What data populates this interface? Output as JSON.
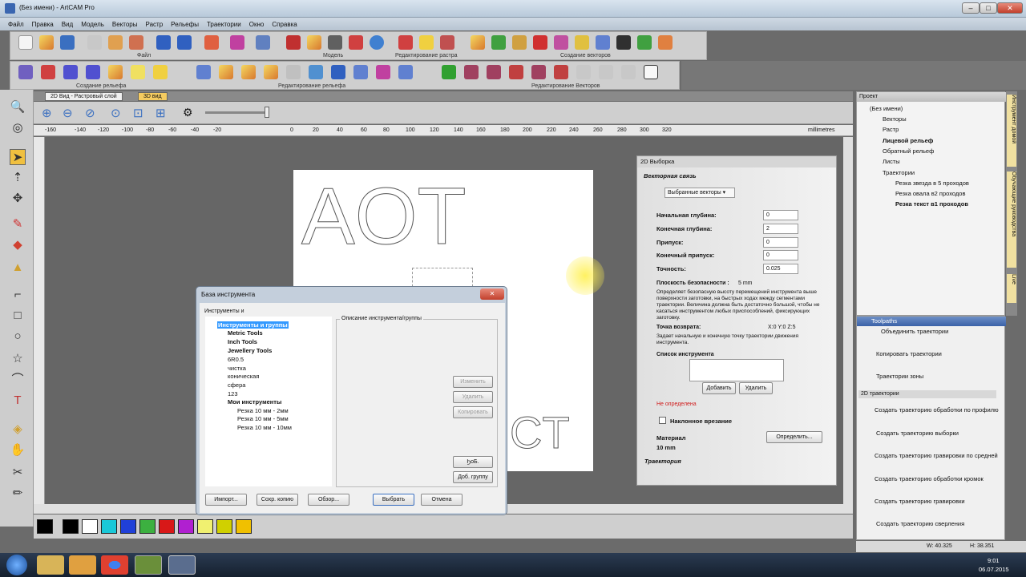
{
  "app": {
    "title": "(Без имени) - ArtCAM Pro"
  },
  "menu": [
    "Файл",
    "Правка",
    "Вид",
    "Модель",
    "Векторы",
    "Растр",
    "Рельефы",
    "Траектории",
    "Окно",
    "Справка"
  ],
  "toolbar_labels": {
    "file": "Файл",
    "model": "Модель",
    "raster_edit": "Редактирование растра",
    "vector_create": "Создание векторов",
    "relief_create": "Создание рельефа",
    "relief_edit": "Редактирование рельефа",
    "vector_edit": "Редактирование Векторов"
  },
  "view_tabs": [
    "2D Вид - Растровый слой",
    "3D вид"
  ],
  "ruler": {
    "ticks": [
      "-160",
      "-140",
      "-120",
      "-100",
      "-80",
      "-60",
      "-40",
      "-20",
      "0",
      "20",
      "40",
      "60",
      "80",
      "100",
      "120",
      "140",
      "160",
      "180",
      "200",
      "220",
      "240",
      "260",
      "280",
      "300",
      "320"
    ],
    "unit": "millimetres"
  },
  "canvas_text": {
    "top": "AOT",
    "bottom": "CT"
  },
  "project": {
    "header": "Проект",
    "root": "(Без имени)",
    "items": [
      "Векторы",
      "Растр",
      "Лицевой рельеф",
      "Обратный рельеф",
      "Листы",
      "Траектории"
    ],
    "toolpaths": [
      "Резка звезда в 5 проходов",
      "Резка овала в2 проходов",
      "Резка текст в1 проходов"
    ]
  },
  "side_tabs": [
    "Инструмент домой",
    "Обучающие руководства",
    "Live"
  ],
  "pick_panel": {
    "title": "2D Выборка",
    "section": "Векторная связь",
    "select_value": "Выбранные векторы",
    "fields": [
      {
        "label": "Начальная глубина:",
        "value": "0"
      },
      {
        "label": "Конечная глубина:",
        "value": "2"
      },
      {
        "label": "Припуск:",
        "value": "0"
      },
      {
        "label": "Конечный припуск:",
        "value": "0"
      },
      {
        "label": "Точность:",
        "value": "0.025"
      }
    ],
    "safe_label": "Плоскость безопасности :",
    "safe_value": "5 mm",
    "safe_desc": "Определяет безопасную высоту перемещений инструмента выше поверхности заготовки, на быстрых ходах между сегментами траектории. Величина должна быть достаточно большой, чтобы не касаться инструментом любых приспособлений, фиксирующих заготовку.",
    "home_label": "Точка возврата:",
    "home_value": "X:0 Y:0 Z:5",
    "home_desc": "Задает начальную и конечную точку траектории движения инструмента.",
    "tool_list": "Список инструмента",
    "add": "Добавить",
    "remove": "Удалить",
    "undefined": "Не определена",
    "ramp": "Наклонное врезание",
    "material": "Материал",
    "define": "Определить...",
    "material_value": "10 mm",
    "trajectory": "Траектория"
  },
  "tools_panel": {
    "title": "Toolpaths",
    "items": [
      "Объединить траектории",
      "Копировать траектории",
      "Траектории зоны"
    ],
    "section": "2D траектории",
    "items2": [
      "Создать траекторию обработки по профилю",
      "Создать траекторию выборки",
      "Создать траекторию гравировки по средней",
      "Создать траекторию обработки кромок",
      "Создать траекторию гравировки",
      "Создать траекторию сверления"
    ]
  },
  "tool_db": {
    "title": "База инструмента",
    "label": "Инструменты и",
    "tree": [
      "Инструменты и группы",
      "Metric Tools",
      "Inch Tools",
      "Jewellery Tools",
      "6R0.5",
      "чистка",
      "коническая",
      "сфера",
      "123",
      "Мои инструменты",
      "Резка 10 мм - 2мм",
      "Резка 10 мм - 5мм",
      "Резка 10 мм - 10мм"
    ],
    "desc_label": "Описание инструмента/группы",
    "side_buttons": [
      "Изменить",
      "Удалить",
      "Копировать",
      "ϦоБ. инструмент",
      "Доб. группу"
    ],
    "buttons": [
      "Импорт...",
      "Сохр. копию",
      "Обзор...",
      "Выбрать",
      "Отмена"
    ]
  },
  "status": {
    "w": "W: 40.325",
    "h": "H: 38.351"
  },
  "clock": {
    "time": "9:01",
    "date": "06.07.2015"
  },
  "colors": {
    "palette": [
      "#000000",
      "#ffffff",
      "#19c8d8",
      "#2040d8",
      "#3cb040",
      "#d81818",
      "#b020d0",
      "#f0f070",
      "#d0d000",
      "#f0c000"
    ]
  }
}
